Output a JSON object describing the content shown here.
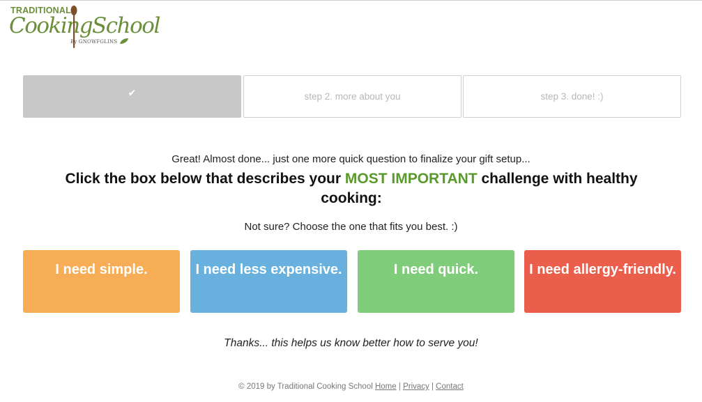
{
  "logo": {
    "top_text": "TRADITIONAL",
    "main_text": "CookingSchool",
    "by_text": "By GNOWFGLINS",
    "icon": "spoon-icon",
    "leaf_icon": "leaf-icon",
    "color": "#6b8e3a"
  },
  "steps": [
    {
      "label": "",
      "icon": "checkmark-icon",
      "state": "complete"
    },
    {
      "label": "step 2. more about you",
      "state": "pending"
    },
    {
      "label": "step 3. done! :)",
      "state": "pending"
    }
  ],
  "intro": "Great! Almost done... just one more quick question to finalize your gift setup...",
  "headline": {
    "before": "Click the box below that describes your ",
    "highlight": "MOST IMPORTANT",
    "after": " challenge with healthy cooking:",
    "highlight_color": "#5a9a2d"
  },
  "not_sure": "Not sure? Choose the one that fits you best. :)",
  "choices": [
    {
      "label": "I need simple.",
      "color": "#f6ad55"
    },
    {
      "label": "I need less expensive.",
      "color": "#68b0dd"
    },
    {
      "label": "I need quick.",
      "color": "#7fcc7a"
    },
    {
      "label": "I need allergy-friendly.",
      "color": "#ea5e4b"
    }
  ],
  "thanks": "Thanks... this helps us know better how to serve you!",
  "footer": {
    "copyright": "© 2019 by Traditional Cooking School",
    "links": [
      "Home",
      "Privacy",
      "Contact"
    ],
    "separator": "|"
  }
}
